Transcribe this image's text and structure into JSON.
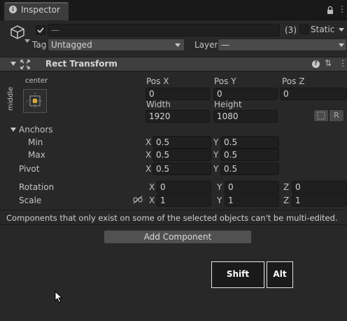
{
  "tab": {
    "title": "Inspector"
  },
  "header": {
    "name_value": "—",
    "count": "(3)",
    "static_label": "Static",
    "tag_label": "Tag",
    "tag_value": "Untagged",
    "layer_label": "Layer",
    "layer_value": "—"
  },
  "component": {
    "title": "Rect Transform",
    "anchor_preset_h": "center",
    "anchor_preset_v": "middle",
    "pos_x_label": "Pos X",
    "pos_y_label": "Pos Y",
    "pos_z_label": "Pos Z",
    "pos_x": "0",
    "pos_y": "0",
    "pos_z": "0",
    "width_label": "Width",
    "height_label": "Height",
    "width": "1920",
    "height": "1080",
    "raw_label": "R",
    "anchors_label": "Anchors",
    "min_label": "Min",
    "max_label": "Max",
    "pivot_label": "Pivot",
    "x": "X",
    "y": "Y",
    "z": "Z",
    "min_x": "0.5",
    "min_y": "0.5",
    "max_x": "0.5",
    "max_y": "0.5",
    "pivot_x": "0.5",
    "pivot_y": "0.5",
    "rotation_label": "Rotation",
    "rot_x": "0",
    "rot_y": "0",
    "rot_z": "0",
    "scale_label": "Scale",
    "scale_x": "1",
    "scale_y": "1",
    "scale_z": "1"
  },
  "message": "Components that only exist on some of the selected objects can't be multi-edited.",
  "add_component": "Add Component",
  "keys": {
    "shift": "Shift",
    "alt": "Alt"
  }
}
